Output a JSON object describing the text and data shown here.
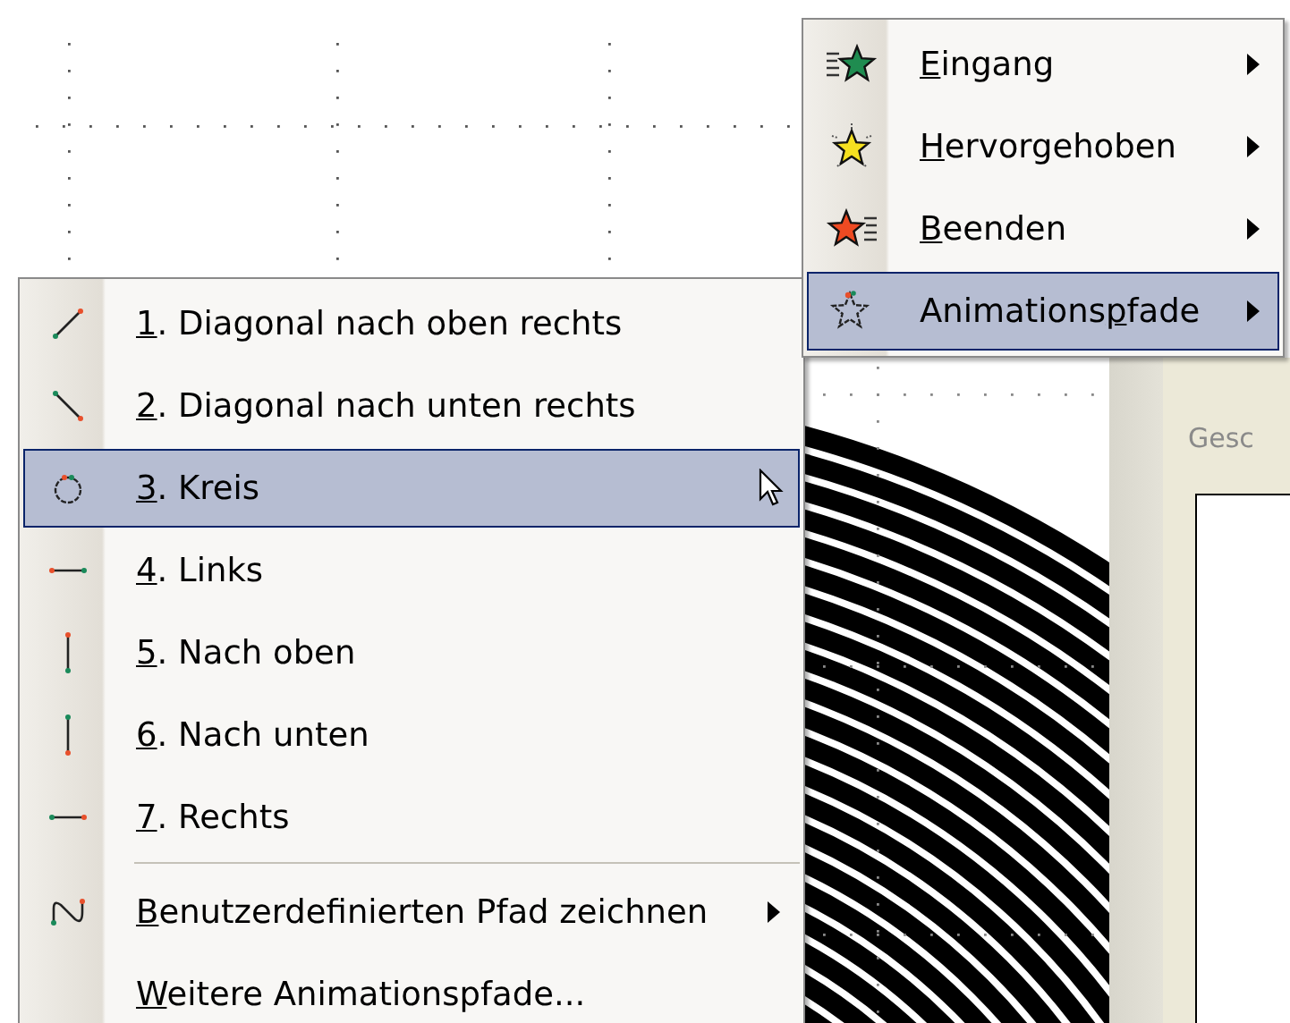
{
  "submenu": {
    "items": [
      {
        "kind": "entrance",
        "accel": "E",
        "after": "ingang",
        "has_submenu": true,
        "selected": false
      },
      {
        "kind": "emphasis",
        "accel": "H",
        "after": "ervorgehoben",
        "has_submenu": true,
        "selected": false
      },
      {
        "kind": "exit",
        "accel": "B",
        "after": "eenden",
        "has_submenu": true,
        "selected": false
      },
      {
        "kind": "path",
        "before": "Animations",
        "accel": "p",
        "after": "fade",
        "has_submenu": true,
        "selected": true
      }
    ]
  },
  "menu": {
    "items": [
      {
        "kind": "diagup",
        "accel": "1",
        "after": ". Diagonal nach oben rechts",
        "has_submenu": false,
        "selected": false
      },
      {
        "kind": "diagdown",
        "accel": "2",
        "after": ". Diagonal nach unten rechts",
        "has_submenu": false,
        "selected": false
      },
      {
        "kind": "circle",
        "accel": "3",
        "after": ". Kreis",
        "has_submenu": false,
        "selected": true
      },
      {
        "kind": "left",
        "accel": "4",
        "after": ". Links",
        "has_submenu": false,
        "selected": false
      },
      {
        "kind": "up",
        "accel": "5",
        "after": ". Nach oben",
        "has_submenu": false,
        "selected": false
      },
      {
        "kind": "down",
        "accel": "6",
        "after": ". Nach unten",
        "has_submenu": false,
        "selected": false
      },
      {
        "kind": "right",
        "accel": "7",
        "after": ". Rechts",
        "has_submenu": false,
        "selected": false
      },
      {
        "kind": "separator"
      },
      {
        "kind": "custom",
        "accel": "B",
        "after": "enutzerdefinierten Pfad zeichnen",
        "has_submenu": true,
        "selected": false
      },
      {
        "kind": "plain",
        "accel": "W",
        "after": "eitere Animationspfade...",
        "has_submenu": false,
        "selected": false
      }
    ]
  },
  "side_pane": {
    "title": "Gesc"
  }
}
